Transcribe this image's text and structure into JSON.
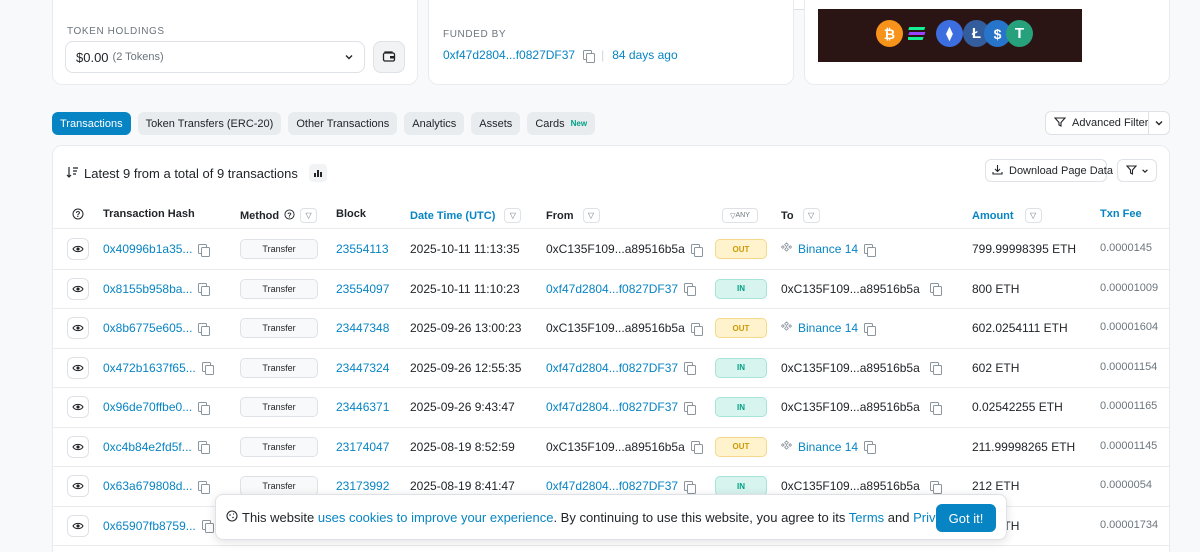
{
  "holdings": {
    "label": "TOKEN HOLDINGS",
    "value": "$0.00",
    "count": "(2 Tokens)"
  },
  "funded": {
    "label": "FUNDED BY",
    "address": "0xf47d2804...f0827DF37",
    "age": "84 days ago"
  },
  "tabs": [
    {
      "label": "Transactions",
      "active": true
    },
    {
      "label": "Token Transfers (ERC-20)"
    },
    {
      "label": "Other Transactions"
    },
    {
      "label": "Analytics"
    },
    {
      "label": "Assets"
    },
    {
      "label": "Cards",
      "badge": "New"
    }
  ],
  "advanced_filter": "Advanced Filter",
  "summary": "Latest 9 from a total of 9 transactions",
  "download": "Download Page Data",
  "columns": {
    "hash": "Transaction Hash",
    "method": "Method",
    "block": "Block",
    "datetime": "Date Time (UTC)",
    "from": "From",
    "any": "ANY",
    "to": "To",
    "amount": "Amount",
    "fee": "Txn Fee"
  },
  "rows": [
    {
      "hash": "0x40996b1a35...",
      "method": "Transfer",
      "block": "23554113",
      "date": "2025-10-11 11:13:35",
      "from": "0xC135F109...a89516b5a",
      "dir": "OUT",
      "to": "Binance 14",
      "amount": "799.99998395 ETH",
      "fee": "0.0000145"
    },
    {
      "hash": "0x8155b958ba...",
      "method": "Transfer",
      "block": "23554097",
      "date": "2025-10-11 11:10:23",
      "from": "0xf47d2804...f0827DF37",
      "dir": "IN",
      "to": "0xC135F109...a89516b5a",
      "amount": "800 ETH",
      "fee": "0.00001009"
    },
    {
      "hash": "0x8b6775e605...",
      "method": "Transfer",
      "block": "23447348",
      "date": "2025-09-26 13:00:23",
      "from": "0xC135F109...a89516b5a",
      "dir": "OUT",
      "to": "Binance 14",
      "amount": "602.0254111 ETH",
      "fee": "0.00001604"
    },
    {
      "hash": "0x472b1637f65...",
      "method": "Transfer",
      "block": "23447324",
      "date": "2025-09-26 12:55:35",
      "from": "0xf47d2804...f0827DF37",
      "dir": "IN",
      "to": "0xC135F109...a89516b5a",
      "amount": "602 ETH",
      "fee": "0.00001154"
    },
    {
      "hash": "0x96de70ffbe0...",
      "method": "Transfer",
      "block": "23446371",
      "date": "2025-09-26 9:43:47",
      "from": "0xf47d2804...f0827DF37",
      "dir": "IN",
      "to": "0xC135F109...a89516b5a",
      "amount": "0.02542255 ETH",
      "fee": "0.00001165"
    },
    {
      "hash": "0xc4b84e2fd5f...",
      "method": "Transfer",
      "block": "23174047",
      "date": "2025-08-19 8:52:59",
      "from": "0xC135F109...a89516b5a",
      "dir": "OUT",
      "to": "Binance 14",
      "amount": "211.99998265 ETH",
      "fee": "0.00001145"
    },
    {
      "hash": "0x63a679808d...",
      "method": "Transfer",
      "block": "23173992",
      "date": "2025-08-19 8:41:47",
      "from": "0xf47d2804...f0827DF37",
      "dir": "IN",
      "to": "0xC135F109...a89516b5a",
      "amount": "212 ETH",
      "fee": "0.0000054"
    },
    {
      "hash": "0x65907fb8759...",
      "method": "",
      "block": "",
      "date": "",
      "from": "",
      "dir": "",
      "to": "",
      "amount": "986 ETH",
      "fee": "0.00001734"
    }
  ],
  "cookie": {
    "pre": "This website",
    "link1": "uses cookies to improve your experience",
    "mid": ". By continuing to use this website, you agree to its",
    "terms": "Terms",
    "and": "and",
    "privacy": "Privacy Policy",
    "end": ".",
    "button": "Got it!"
  }
}
